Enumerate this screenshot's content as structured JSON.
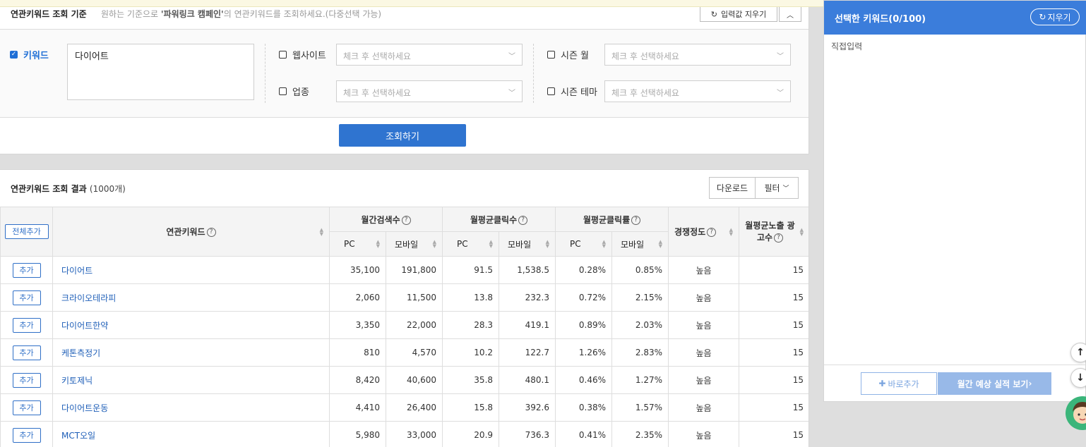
{
  "criteria": {
    "title": "연관키워드 조회 기준",
    "desc_prefix": "원하는 기준으로 ",
    "desc_bold": "'파워링크 캠페인'",
    "desc_suffix": "의 연관키워드를 조회하세요.(다중선택 가능)",
    "reset_label": "입력값 지우기",
    "keyword_label": "키워드",
    "keyword_value": "다이어트",
    "website_label": "웹사이트",
    "industry_label": "업종",
    "season_month_label": "시즌 월",
    "season_theme_label": "시즌 테마",
    "select_placeholder": "체크 후 선택하세요",
    "search_button": "조회하기"
  },
  "results": {
    "title": "연관키워드 조회 결과",
    "count": "(1000개)",
    "download": "다운로드",
    "filter": "필터",
    "add_all": "전체추가",
    "col_keyword": "연관키워드",
    "col_search": "월간검색수",
    "col_click": "월평균클릭수",
    "col_ctr": "월평균클릭률",
    "col_comp": "경쟁정도",
    "col_ads": "월평균노출 광고수",
    "sub_pc": "PC",
    "sub_mobile": "모바일",
    "add_label": "추가",
    "rows": [
      {
        "kw": "다이어트",
        "s_pc": "35,100",
        "s_m": "191,800",
        "c_pc": "91.5",
        "c_m": "1,538.5",
        "r_pc": "0.28%",
        "r_m": "0.85%",
        "comp": "높음",
        "ads": "15"
      },
      {
        "kw": "크라이오테라피",
        "s_pc": "2,060",
        "s_m": "11,500",
        "c_pc": "13.8",
        "c_m": "232.3",
        "r_pc": "0.72%",
        "r_m": "2.15%",
        "comp": "높음",
        "ads": "15"
      },
      {
        "kw": "다이어트한약",
        "s_pc": "3,350",
        "s_m": "22,000",
        "c_pc": "28.3",
        "c_m": "419.1",
        "r_pc": "0.89%",
        "r_m": "2.03%",
        "comp": "높음",
        "ads": "15"
      },
      {
        "kw": "케톤측정기",
        "s_pc": "810",
        "s_m": "4,570",
        "c_pc": "10.2",
        "c_m": "122.7",
        "r_pc": "1.26%",
        "r_m": "2.83%",
        "comp": "높음",
        "ads": "15"
      },
      {
        "kw": "키토제닉",
        "s_pc": "8,420",
        "s_m": "40,600",
        "c_pc": "35.8",
        "c_m": "480.1",
        "r_pc": "0.46%",
        "r_m": "1.27%",
        "comp": "높음",
        "ads": "15"
      },
      {
        "kw": "다이어트운동",
        "s_pc": "4,410",
        "s_m": "26,400",
        "c_pc": "15.8",
        "c_m": "392.6",
        "r_pc": "0.38%",
        "r_m": "1.57%",
        "comp": "높음",
        "ads": "15"
      },
      {
        "kw": "MCT오일",
        "s_pc": "5,980",
        "s_m": "33,000",
        "c_pc": "20.9",
        "c_m": "736.3",
        "r_pc": "0.41%",
        "r_m": "2.35%",
        "comp": "높음",
        "ads": "15"
      }
    ]
  },
  "selected": {
    "title": "선택한 키워드(0/100)",
    "clear": "지우기",
    "direct_input": "직접입력",
    "add_direct": "바로추가",
    "forecast": "월간 예상 실적 보기"
  }
}
